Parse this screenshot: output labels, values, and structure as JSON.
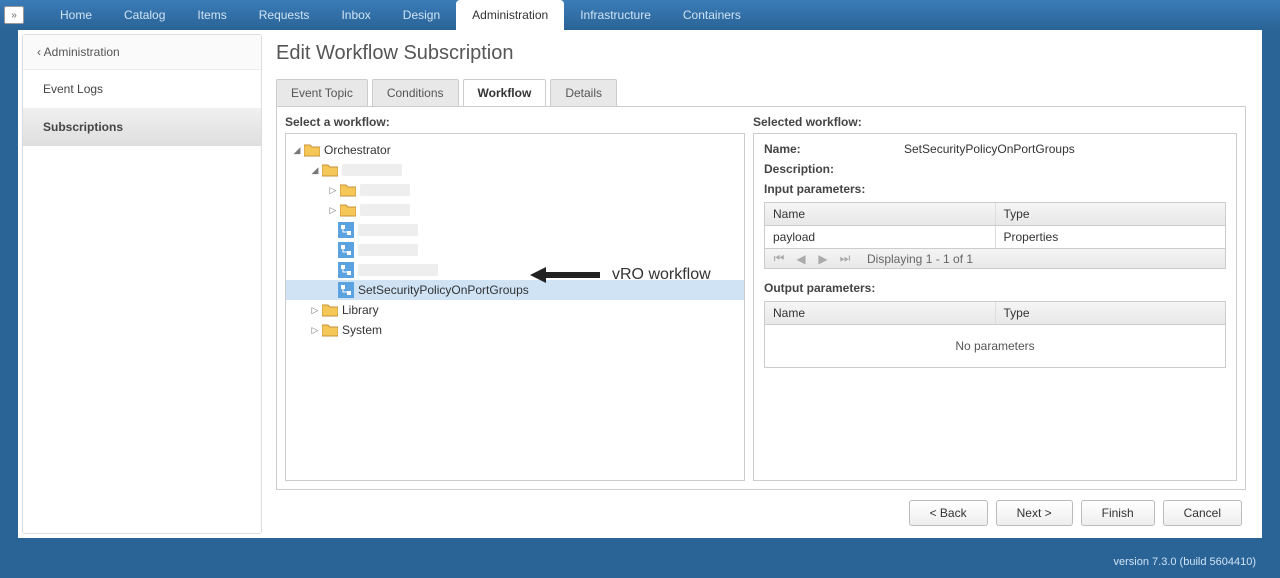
{
  "topnav": {
    "items": [
      "Home",
      "Catalog",
      "Items",
      "Requests",
      "Inbox",
      "Design",
      "Administration",
      "Infrastructure",
      "Containers"
    ],
    "active": "Administration"
  },
  "sidebar": {
    "back_label": "Administration",
    "items": [
      {
        "label": "Event Logs",
        "active": false
      },
      {
        "label": "Subscriptions",
        "active": true
      }
    ]
  },
  "page_title": "Edit Workflow Subscription",
  "subtabs": {
    "items": [
      "Event Topic",
      "Conditions",
      "Workflow",
      "Details"
    ],
    "active": "Workflow"
  },
  "left": {
    "header": "Select a workflow:",
    "tree": {
      "root": "Orchestrator",
      "library": "Library",
      "system": "System",
      "selected": "SetSecurityPolicyOnPortGroups"
    }
  },
  "right": {
    "header": "Selected workflow:",
    "name_label": "Name:",
    "name_value": "SetSecurityPolicyOnPortGroups",
    "desc_label": "Description:",
    "input_label": "Input parameters:",
    "output_label": "Output parameters:",
    "col_name": "Name",
    "col_type": "Type",
    "row_name": "payload",
    "row_type": "Properties",
    "pager_text": "Displaying 1 - 1 of 1",
    "no_params": "No parameters"
  },
  "buttons": {
    "back": "< Back",
    "next": "Next >",
    "finish": "Finish",
    "cancel": "Cancel"
  },
  "footer": {
    "version": "version 7.3.0 (build 5604410)"
  },
  "annotation": {
    "text": "vRO workflow"
  }
}
